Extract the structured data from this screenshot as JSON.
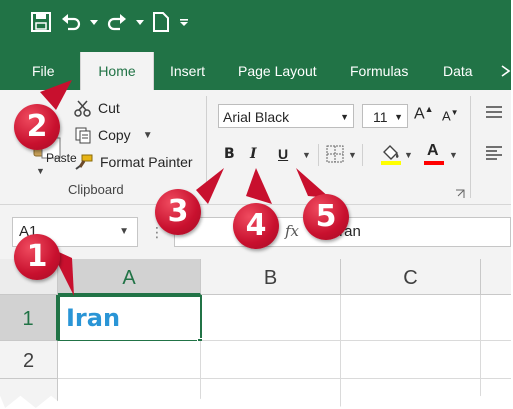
{
  "ribbon_tabs": [
    "File",
    "Home",
    "Insert",
    "Page Layout",
    "Formulas",
    "Data"
  ],
  "active_tab": "Home",
  "clipboard": {
    "cut_label": "Cut",
    "copy_label": "Copy",
    "format_painter_label": "Format Painter",
    "paste_label": "Paste",
    "group_label": "Clipboard"
  },
  "font": {
    "family": "Arial Black",
    "size": "11",
    "bold_label": "B",
    "italic_label": "I",
    "underline_label": "U",
    "font_color_label": "A",
    "grow_label": "A",
    "shrink_label": "A"
  },
  "formula_bar": {
    "name_box": "A1",
    "fx_label": "fx",
    "content": "Iran"
  },
  "columns": [
    "A",
    "B",
    "C"
  ],
  "rows": [
    "1",
    "2"
  ],
  "cells": {
    "A1": "Iran"
  },
  "markers": [
    "1",
    "2",
    "3",
    "4",
    "5"
  ],
  "colors": {
    "excel_green": "#217346",
    "cell_text": "#2a95d6",
    "marker_red": "#c8102e",
    "highlight_yellow": "#ffff00",
    "font_color_red": "#ff0000"
  }
}
